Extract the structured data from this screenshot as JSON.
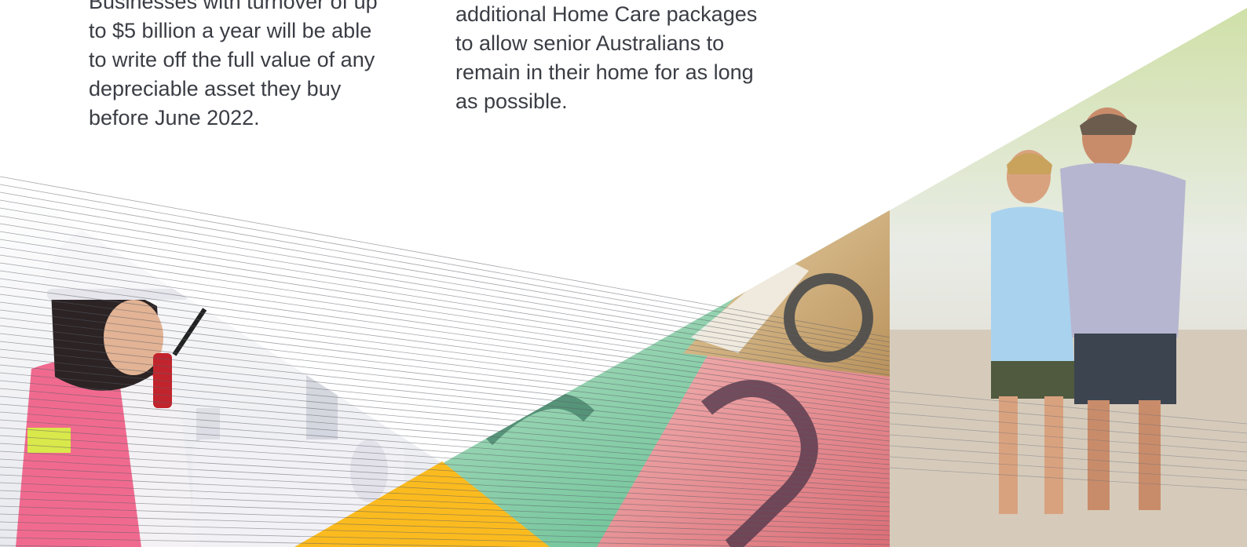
{
  "columns": {
    "left": {
      "lines": [
        "Businesses with turnover of up",
        "to $5 billion a year will be able",
        "to write off the full value of any",
        "depreciable asset they buy",
        "before June 2022."
      ]
    },
    "middle": {
      "lines": [
        "additional Home Care packages",
        "to allow senior Australians to",
        "remain in their home for as long",
        "as possible."
      ]
    }
  },
  "colors": {
    "text": "#3a3d44",
    "accent_yellow": "#fbbb1f",
    "note_green": "#5fc18e",
    "note_red": "#e97a7e",
    "note_tan": "#c9a36d"
  },
  "imagery": {
    "left_photo": "worker-with-hard-hat-and-radio",
    "middle_photo": "australian-banknotes",
    "right_photo": "senior-couple-walking"
  }
}
